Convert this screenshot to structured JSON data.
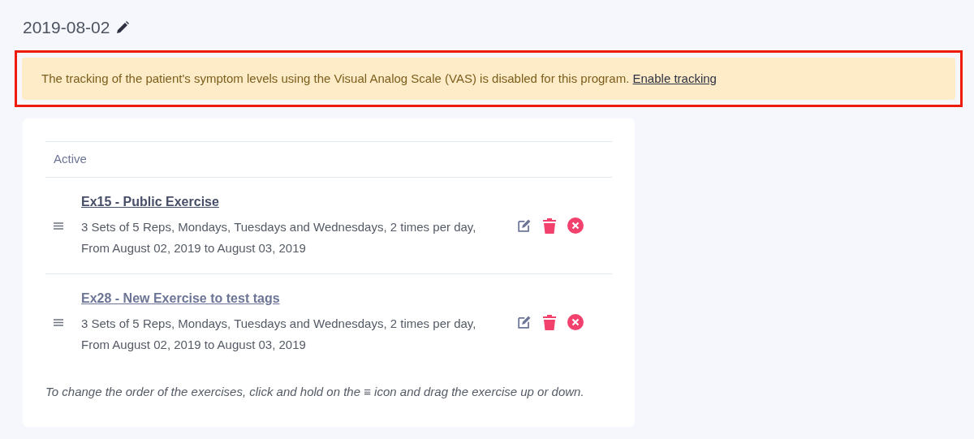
{
  "title": "2019-08-02",
  "alert": {
    "highlighted": true,
    "text": "The tracking of the patient's symptom levels using the Visual Analog Scale (VAS) is disabled for this program.",
    "link": "Enable tracking"
  },
  "section": {
    "heading": "Active"
  },
  "exercises": [
    {
      "name": "Ex15 - Public Exercise",
      "visited": false,
      "description": "3 Sets of 5 Reps, Mondays, Tuesdays and Wednesdays, 2 times per day, From August 02, 2019 to August 03, 2019"
    },
    {
      "name": "Ex28 - New Exercise to test tags",
      "visited": true,
      "description": "3 Sets of 5 Reps, Mondays, Tuesdays and Wednesdays, 2 times per day, From August 02, 2019 to August 03, 2019"
    }
  ],
  "hint": "To change the order of the exercises, click and hold on the ≡ icon and drag the exercise up or down."
}
